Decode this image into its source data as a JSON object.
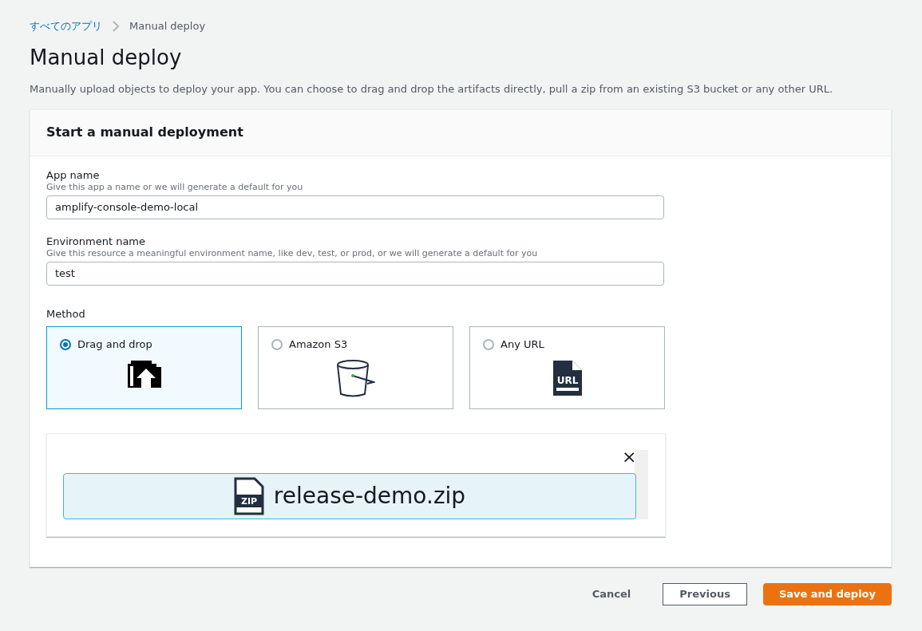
{
  "breadcrumb": [
    {
      "label": "すべてのアプリ",
      "kind": "link"
    },
    {
      "label": "Manual deploy",
      "kind": "current"
    }
  ],
  "title": "Manual deploy",
  "description": "Manually upload objects to deploy your app. You can choose to drag and drop the artifacts directly, pull a zip from an existing S3 bucket or any other URL.",
  "card": {
    "title": "Start a manual deployment",
    "fields": [
      {
        "label": "App name",
        "hint": "Give this app a name or we will generate a default for you",
        "value": "amplify-console-demo-local"
      },
      {
        "label": "Environment name",
        "hint": "Give this resource a meaningful environment name, like dev, test, or prod, or we will generate a default for you",
        "value": "test"
      }
    ],
    "method": {
      "label": "Method",
      "options": [
        {
          "label": "Drag and drop",
          "kind": "upload",
          "selected": true
        },
        {
          "label": "Amazon S3",
          "kind": "bucket",
          "selected": false
        },
        {
          "label": "Any URL",
          "kind": "url",
          "icon_text": "URL",
          "selected": false
        }
      ]
    },
    "upload": {
      "file_name": "release-demo.zip",
      "icon_text": "ZIP",
      "close": "×"
    }
  },
  "buttons": [
    {
      "label": "Cancel",
      "kind": "link"
    },
    {
      "label": "Previous",
      "kind": "normal"
    },
    {
      "label": "Save and deploy",
      "kind": "primary"
    }
  ]
}
